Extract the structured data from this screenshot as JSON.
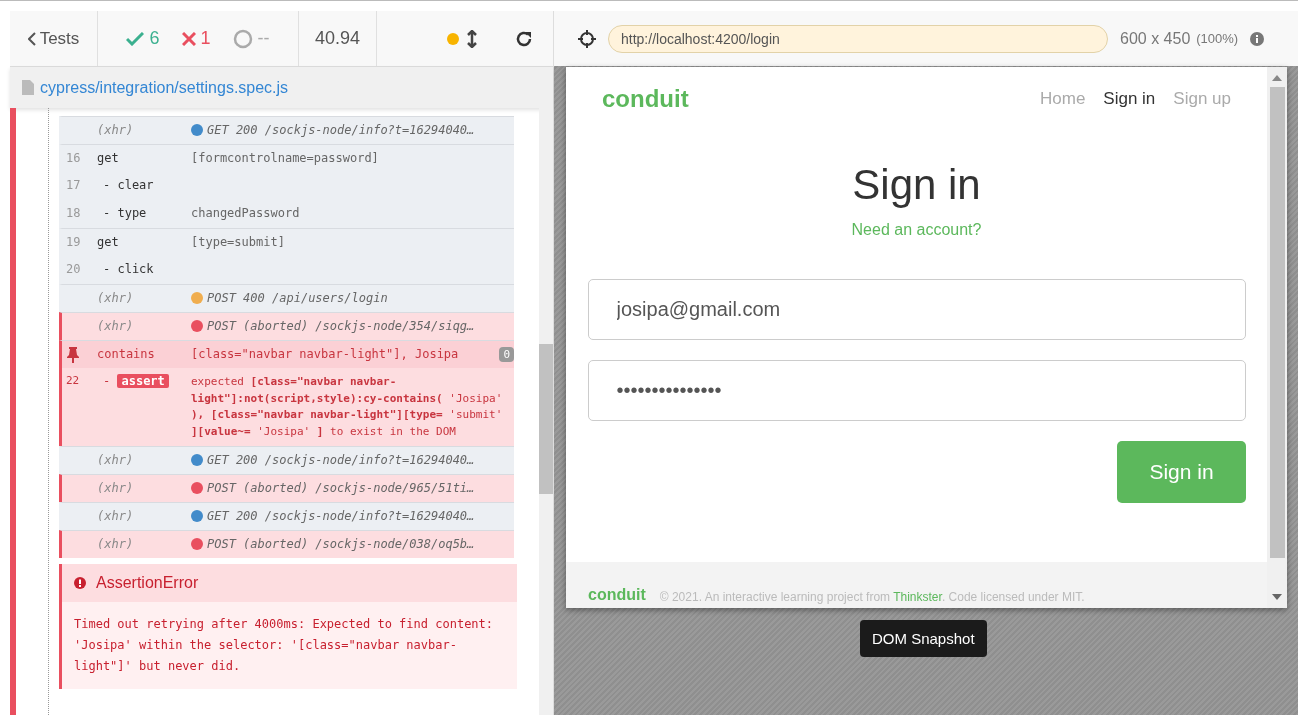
{
  "reporter": {
    "back_label": "Tests",
    "passed": "6",
    "failed": "1",
    "pending": "--",
    "duration": "40.94",
    "spec_path": "cypress/integration/settings.spec.js"
  },
  "log": [
    {
      "kind": "xhr",
      "name": "(xhr)",
      "message": "GET 200 /sockjs-node/info?t=16294040…",
      "color": "#428bca",
      "failed": false
    },
    {
      "kind": "command",
      "number": "16",
      "name": "get",
      "message": "[formcontrolname=password]",
      "failed": false
    },
    {
      "kind": "child",
      "number": "17",
      "name": "- clear",
      "failed": false
    },
    {
      "kind": "child",
      "number": "18",
      "name": "- type",
      "message": "changedPassword",
      "failed": false
    },
    {
      "kind": "command",
      "number": "19",
      "name": "get",
      "message": "[type=submit]",
      "failed": false
    },
    {
      "kind": "child",
      "number": "20",
      "name": "- click",
      "failed": false
    },
    {
      "kind": "xhr",
      "name": "(xhr)",
      "message": "POST 400 /api/users/login",
      "color": "#f0ad4e",
      "failed": false
    },
    {
      "kind": "xhr",
      "name": "(xhr)",
      "message": "POST (aborted) /sockjs-node/354/siqg…",
      "color": "#e94f5f",
      "failed": true
    },
    {
      "kind": "pinned",
      "name": "contains",
      "message": "[class=\"navbar navbar-light\"], Josipa",
      "count": "0",
      "failed": true
    },
    {
      "kind": "assert",
      "number": "22",
      "dash": "-",
      "name": "assert",
      "message": "expected **[class=\"navbar navbar-light\"]:not(script,style):cy-contains(** 'Josipa' **), [class=\"navbar navbar-light\"][type=** 'submit' **][value~=** 'Josipa' **]** to exist in the DOM",
      "failed": true
    },
    {
      "kind": "xhr",
      "name": "(xhr)",
      "message": "GET 200 /sockjs-node/info?t=16294040…",
      "color": "#428bca",
      "failed": false
    },
    {
      "kind": "xhr",
      "name": "(xhr)",
      "message": "POST (aborted) /sockjs-node/965/51ti…",
      "color": "#e94f5f",
      "failed": true
    },
    {
      "kind": "xhr",
      "name": "(xhr)",
      "message": "GET 200 /sockjs-node/info?t=16294040…",
      "color": "#428bca",
      "failed": false
    },
    {
      "kind": "xhr",
      "name": "(xhr)",
      "message": "POST (aborted) /sockjs-node/038/oq5b…",
      "color": "#e94f5f",
      "failed": true
    }
  ],
  "error": {
    "title": "AssertionError",
    "message": "Timed out retrying after 4000ms: Expected to find content: 'Josipa' within the selector: '[class=\"navbar navbar-light\"]' but never did."
  },
  "runner": {
    "url": "http://localhost:4200/login",
    "viewport": "600 x 450",
    "scale": "(100%)",
    "tooltip": "DOM Snapshot"
  },
  "app": {
    "brand": "conduit",
    "nav": [
      {
        "label": "Home",
        "selected": false
      },
      {
        "label": "Sign in",
        "selected": true
      },
      {
        "label": "Sign up",
        "selected": false
      }
    ],
    "title": "Sign in",
    "need_account": "Need an account?",
    "email": "josipa@gmail.com",
    "password": "•••••••••••••••",
    "submit": "Sign in",
    "footer": {
      "brand": "conduit",
      "text_before": "© 2021. An interactive learning project from",
      "link": "Thinkster",
      "text_after": ". Code licensed under MIT."
    }
  }
}
